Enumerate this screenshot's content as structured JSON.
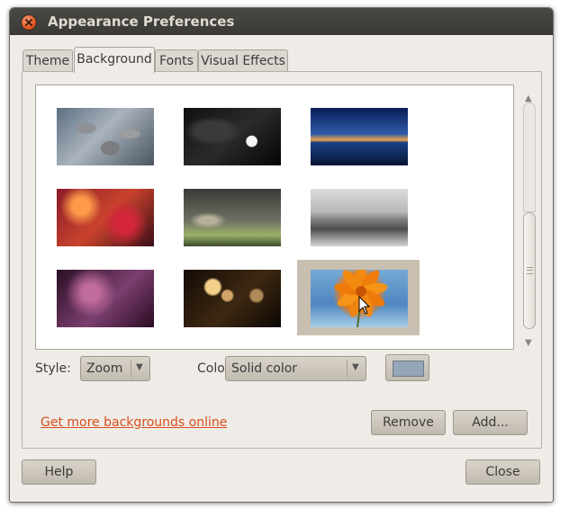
{
  "window": {
    "title": "Appearance Preferences"
  },
  "tabs": [
    {
      "label": "Theme"
    },
    {
      "label": "Background",
      "selected": true
    },
    {
      "label": "Fonts"
    },
    {
      "label": "Visual Effects"
    }
  ],
  "background": {
    "wallpapers": [
      {
        "icon": "pebbles-wallpaper"
      },
      {
        "icon": "white-flower-dark-wallpaper"
      },
      {
        "icon": "pier-sunset-wallpaper"
      },
      {
        "icon": "red-orange-bokeh-wallpaper"
      },
      {
        "icon": "blurred-grass-wallpaper"
      },
      {
        "icon": "glass-of-water-wallpaper"
      },
      {
        "icon": "purple-bokeh-wallpaper"
      },
      {
        "icon": "golden-bokeh-wallpaper"
      },
      {
        "icon": "orange-flower-wallpaper",
        "selected": true
      }
    ],
    "style_label": "Style:",
    "style_value": "Zoom",
    "colors_label": "Colors:",
    "colors_value": "Solid color",
    "swatch_color": "#95a6b9",
    "more_link": "Get more backgrounds online",
    "remove_label": "Remove",
    "add_label": "Add..."
  },
  "footer": {
    "help_label": "Help",
    "close_label": "Close"
  },
  "colors": {
    "titlebar": "#3c3b37",
    "accent_link": "#d84f1c",
    "selection": "#c8bfb1"
  }
}
